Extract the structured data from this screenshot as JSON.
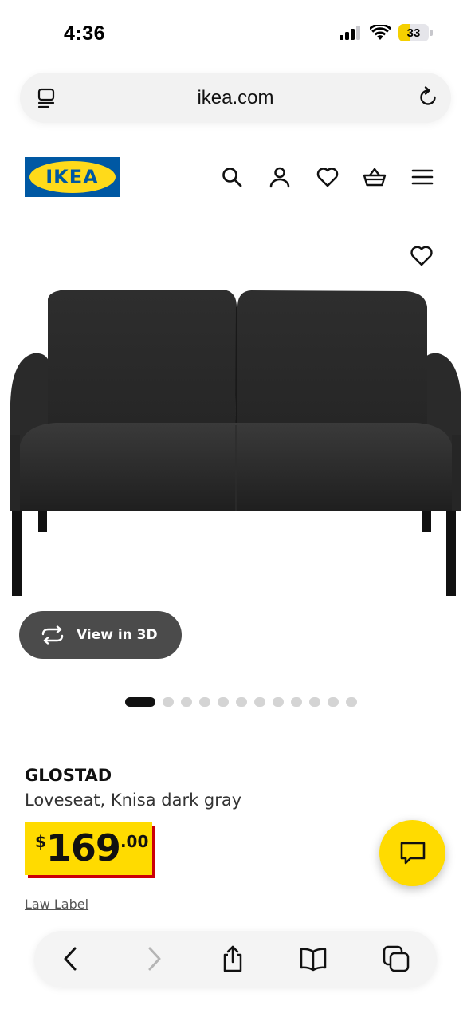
{
  "status_bar": {
    "time": "4:36",
    "battery": "33",
    "icons": [
      "cellular-signal-icon",
      "wifi-icon",
      "battery-icon"
    ]
  },
  "browser": {
    "url": "ikea.com",
    "left_icon": "reader-view-icon",
    "right_icon": "reload-icon"
  },
  "header": {
    "logo": "IKEA",
    "icons": [
      "search-icon",
      "account-icon",
      "heart-icon",
      "shopping-basket-icon",
      "hamburger-menu-icon"
    ]
  },
  "product": {
    "name": "GLOSTAD",
    "description": "Loveseat, Knisa dark gray",
    "image": "sofa-image",
    "view_3d_label": "View in 3D",
    "image_count": 12,
    "active_image": 1,
    "price": {
      "currency": "$",
      "integer": "169",
      "decimal": ".00"
    },
    "law_label": "Law Label"
  },
  "chat_icon": "chat-icon",
  "toolbar": {
    "icons": [
      "back-icon",
      "forward-icon",
      "share-icon",
      "bookmarks-icon",
      "tabs-icon"
    ]
  },
  "colors": {
    "ikea_blue": "#0058a3",
    "ikea_yellow": "#ffdb00",
    "price_shadow_red": "#cc0008",
    "view3d_bg": "#4b4b4b",
    "battery_fill": "#f5d000"
  }
}
